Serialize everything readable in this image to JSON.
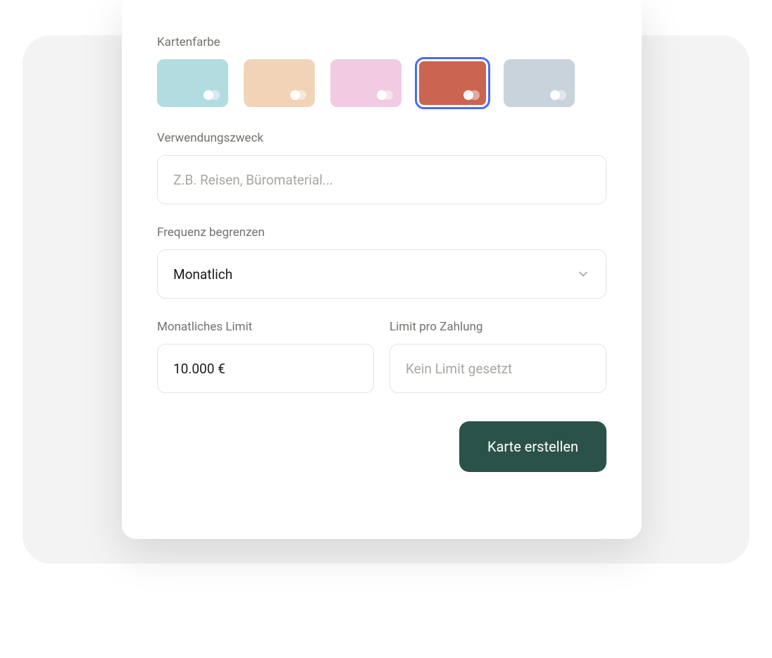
{
  "labels": {
    "color": "Kartenfarbe",
    "purpose": "Verwendungszweck",
    "frequency": "Frequenz begrenzen",
    "monthly_limit": "Monatliches Limit",
    "per_payment_limit": "Limit pro Zahlung"
  },
  "colors": {
    "options": [
      {
        "id": "teal",
        "hex": "#b2dce0",
        "selected": false
      },
      {
        "id": "peach",
        "hex": "#f1d4b8",
        "selected": false
      },
      {
        "id": "pink",
        "hex": "#f0cbe1",
        "selected": false
      },
      {
        "id": "terracotta",
        "hex": "#c96550",
        "selected": true
      },
      {
        "id": "slate",
        "hex": "#c9d3dc",
        "selected": false
      }
    ],
    "selected_index": 3
  },
  "purpose": {
    "placeholder": "Z.B. Reisen, Büromaterial...",
    "value": ""
  },
  "frequency": {
    "selected": "Monatlich"
  },
  "monthly_limit": {
    "value": "10.000 €"
  },
  "per_payment_limit": {
    "placeholder": "Kein Limit gesetzt",
    "value": ""
  },
  "actions": {
    "submit": "Karte erstellen"
  }
}
